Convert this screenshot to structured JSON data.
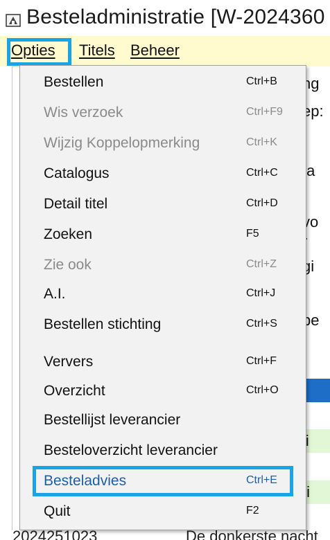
{
  "window": {
    "title": "Besteladministratie [W-2024360"
  },
  "menubar": {
    "opties": "Opties",
    "titels": "Titels",
    "beheer": "Beheer"
  },
  "background": {
    "fragments": [
      "ng",
      "ep:",
      "ta",
      "vo",
      "r",
      "gi",
      "be",
      "t",
      "li",
      "ti"
    ],
    "bottom_row": {
      "id": "2024251023",
      "title": "De donkerste nacht"
    }
  },
  "dropdown": {
    "items": [
      {
        "label": "Bestellen",
        "shortcut": "Ctrl+B",
        "enabled": true
      },
      {
        "label": "Wis verzoek",
        "shortcut": "Ctrl+F9",
        "enabled": false
      },
      {
        "label": "Wijzig Koppelopmerking",
        "shortcut": "Ctrl+K",
        "enabled": false
      },
      {
        "label": "Catalogus",
        "shortcut": "Ctrl+C",
        "enabled": true
      },
      {
        "label": "Detail titel",
        "shortcut": "Ctrl+D",
        "enabled": true
      },
      {
        "label": "Zoeken",
        "shortcut": "F5",
        "enabled": true
      },
      {
        "label": "Zie ook",
        "shortcut": "Ctrl+Z",
        "enabled": false
      },
      {
        "label": "A.I.",
        "shortcut": "Ctrl+J",
        "enabled": true
      },
      {
        "label": "Bestellen stichting",
        "shortcut": "Ctrl+S",
        "enabled": true
      },
      {
        "label": "Ververs",
        "shortcut": "Ctrl+F",
        "enabled": true
      },
      {
        "label": "Overzicht",
        "shortcut": "Ctrl+O",
        "enabled": true
      },
      {
        "label": "Bestellijst leverancier",
        "shortcut": "",
        "enabled": true
      },
      {
        "label": "Besteloverzicht leverancier",
        "shortcut": "",
        "enabled": true
      },
      {
        "label": "Besteladvies",
        "shortcut": "Ctrl+E",
        "enabled": true,
        "selected": true
      },
      {
        "label": "Quit",
        "shortcut": "F2",
        "enabled": true
      }
    ]
  },
  "colors": {
    "menubar_bg": "#fffbcf",
    "highlight_border": "#1ba3e8",
    "selected_text": "#1c5fa8",
    "disabled_text": "#8a8a8a"
  }
}
